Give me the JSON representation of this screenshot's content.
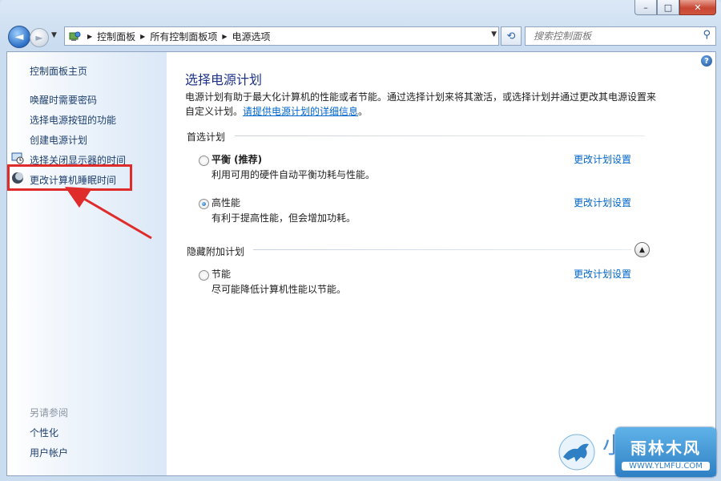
{
  "window": {
    "caption": {
      "minimize": "–",
      "maximize": "□",
      "close": "✕"
    }
  },
  "toolbar": {
    "back_glyph": "◄",
    "forward_glyph": "►",
    "breadcrumbs": [
      "控制面板",
      "所有控制面板项",
      "电源选项"
    ],
    "search_placeholder": "搜索控制面板"
  },
  "sidebar": {
    "home": "控制面板主页",
    "links": [
      "唤醒时需要密码",
      "选择电源按钮的功能",
      "创建电源计划",
      "选择关闭显示器的时间",
      "更改计算机睡眠时间"
    ],
    "see_also_title": "另请参阅",
    "see_also": [
      "个性化",
      "用户帐户"
    ]
  },
  "main": {
    "title": "选择电源计划",
    "description": "电源计划有助于最大化计算机的性能或者节能。通过选择计划来将其激活，或选择计划并通过更改其电源设置来自定义计划。",
    "details_link": "请提供电源计划的详细信息",
    "preferred_label": "首选计划",
    "hidden_label": "隐藏附加计划",
    "change_link": "更改计划设置",
    "plans": [
      {
        "name": "平衡 (推荐)",
        "desc": "利用可用的硬件自动平衡功耗与性能。",
        "selected": false
      },
      {
        "name": "高性能",
        "desc": "有利于提高性能，但会增加功耗。",
        "selected": true
      },
      {
        "name": "节能",
        "desc": "尽可能降低计算机性能以节能。",
        "selected": false
      }
    ]
  },
  "watermark": {
    "text_partial": "小",
    "badge_title": "雨林木风",
    "badge_url": "WWW.YLMFU.COM"
  },
  "colors": {
    "link": "#0066cc",
    "title": "#1e3287",
    "highlight": "#e02b2b"
  }
}
